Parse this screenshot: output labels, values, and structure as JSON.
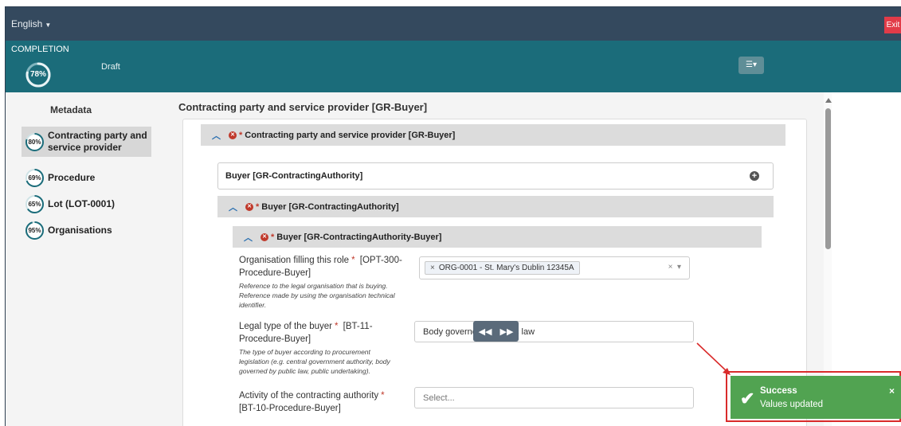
{
  "topbar": {
    "language": "English",
    "exit_label": "Exit"
  },
  "completion": {
    "title": "COMPLETION",
    "percent": "78%",
    "percent_value": 78,
    "status": "Draft"
  },
  "colors": {
    "topbar": "#34495e",
    "completion_bar": "#1b6c7a",
    "error": "#c0392b",
    "success": "#51a351",
    "highlight": "#d92b2b"
  },
  "sidebar": {
    "title": "Metadata",
    "items": [
      {
        "label": "Contracting party and service provider",
        "percent": "80%",
        "value": 80,
        "active": true
      },
      {
        "label": "Procedure",
        "percent": "69%",
        "value": 69,
        "active": false
      },
      {
        "label": "Lot (LOT-0001)",
        "percent": "65%",
        "value": 65,
        "active": false
      },
      {
        "label": "Organisations",
        "percent": "95%",
        "value": 95,
        "active": false
      }
    ]
  },
  "main": {
    "page_title": "Contracting party and service provider [GR-Buyer]",
    "section_header": "Contracting party and service provider  [GR-Buyer]",
    "collapsed_group": "Buyer  [GR-ContractingAuthority]",
    "group_header": "Buyer  [GR-ContractingAuthority]",
    "subgroup_header": "Buyer  [GR-ContractingAuthority-Buyer]",
    "required_mark": "*",
    "fields": [
      {
        "label_line1": "Organisation filling this role",
        "label_line1_suffix": " [OPT-300-",
        "label_line2": "Procedure-Buyer]",
        "help": [
          "Reference to the legal organisation that is buying.",
          "Reference made by using the organisation technical",
          "identifier."
        ],
        "value": "ORG-0001 - St. Mary's Dublin 12345A"
      },
      {
        "label_line1": "Legal type of the buyer",
        "label_line1_suffix": " [BT-11-",
        "label_line2": "Procedure-Buyer]",
        "help": [
          "The type of buyer according to procurement",
          "legislation (e.g. central government authority, body",
          "governed by public law, public undertaking)."
        ],
        "value": "Body governed by public law"
      },
      {
        "label_line1": "Activity of the contracting authority",
        "label_line2": "[BT-10-Procedure-Buyer]",
        "placeholder": "Select..."
      }
    ]
  },
  "toast": {
    "title": "Success",
    "message": "Values updated",
    "close": "×"
  }
}
